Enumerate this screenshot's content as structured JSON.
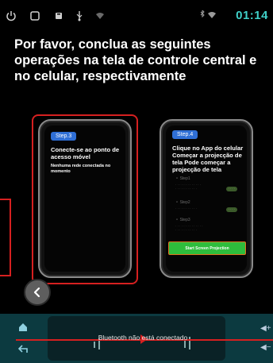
{
  "status_bar": {
    "time": "01:14",
    "icons": [
      "power-icon",
      "square-icon",
      "media-icon",
      "usb-icon",
      "wifi-icon",
      "bluetooth-icon"
    ]
  },
  "instruction": "Por favor, conclua as seguintes operações na tela de controle central e no celular, respectivamente",
  "phone_left": {
    "step": "Step.3",
    "title": "Conecte-se ao ponto de acesso móvel",
    "subtitle": "Nenhuma rede conectada no momento"
  },
  "phone_right": {
    "step": "Step.4",
    "title": "Clique no App do celular Começar a projecção de tela Pode começar a projecção de tela",
    "start_button": "Start Screen Projection"
  },
  "bottom_bar": {
    "bluetooth_status": "Bluetooth não está conectado"
  },
  "colors": {
    "accent": "#3fd0c8",
    "highlight": "#d62020",
    "step_badge": "#2f6fd6",
    "start_button": "#2ebd3c"
  }
}
